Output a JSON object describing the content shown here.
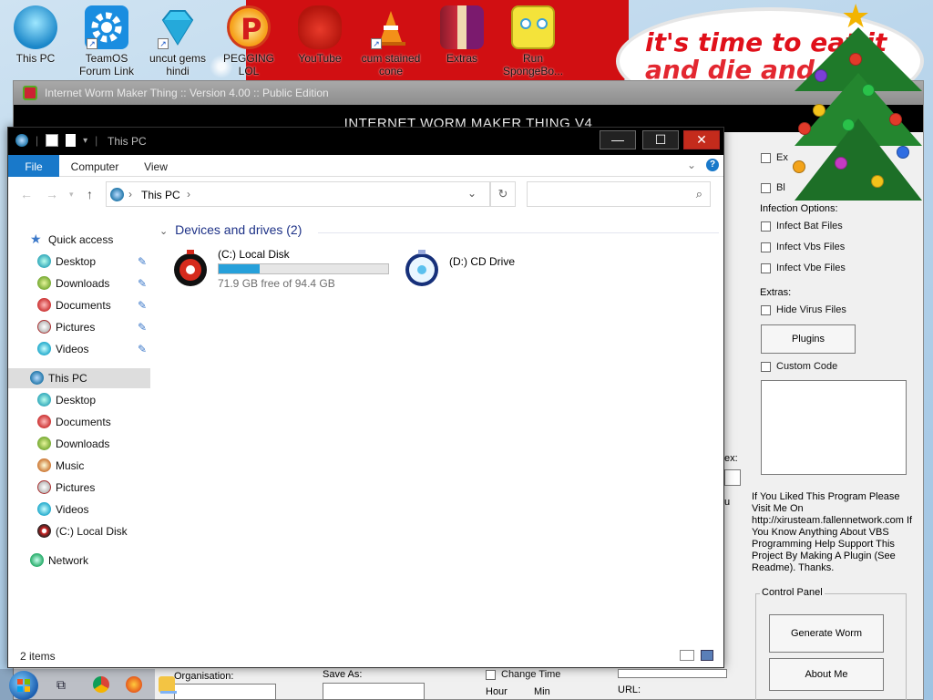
{
  "desktop": {
    "icons": [
      {
        "label": "This PC",
        "icon": "this-pc-icon"
      },
      {
        "label": "TeamOS Forum Link",
        "icon": "gear-icon"
      },
      {
        "label": "uncut gems hindi",
        "icon": "diamond-icon"
      },
      {
        "label": "PEGGING LOL",
        "icon": "letter-p-icon"
      },
      {
        "label": "YouTube",
        "icon": "angry-bird-icon"
      },
      {
        "label": "cum stained cone",
        "icon": "traffic-cone-icon"
      },
      {
        "label": "Extras",
        "icon": "winrar-icon"
      },
      {
        "label": "Run SpongeBo...",
        "icon": "spongebob-icon"
      }
    ],
    "banner": {
      "line1": "it's time to eat it",
      "line2": "and die and"
    }
  },
  "worm_app": {
    "title": "Internet Worm Maker Thing :: Version 4.00 :: Public Edition",
    "heading": "INTERNET WORM MAKER THING V4",
    "checkbox_ex": "Ex",
    "checkbox_bl": "Bl",
    "infection_options_label": "Infection Options:",
    "infect_bat": "Infect Bat Files",
    "infect_vbs": "Infect Vbs Files",
    "infect_vbe": "Infect Vbe Files",
    "extras_label": "Extras:",
    "hide_virus": "Hide Virus Files",
    "plugins_button": "Plugins",
    "custom_code": "Custom Code",
    "partial_ex": "ex:",
    "partial_u": "u",
    "info_text": "If You Liked This Program Please Visit Me On http://xirusteam.fallennetwork.com If You Know Anything About VBS Programming Help Support This Project By Making A Plugin (See Readme). Thanks.",
    "control_panel_label": "Control Panel",
    "generate_button": "Generate Worm",
    "about_button": "About Me",
    "organisation_label": "Organisation:",
    "save_as_label": "Save As:",
    "change_time_label": "Change Time",
    "hour_label": "Hour",
    "min_label": "Min",
    "url_label": "URL:"
  },
  "explorer": {
    "title": "This PC",
    "tabs": [
      "File",
      "Computer",
      "View"
    ],
    "breadcrumb": "This PC",
    "nav": {
      "quick_access": "Quick access",
      "quick_items": [
        "Desktop",
        "Downloads",
        "Documents",
        "Pictures",
        "Videos"
      ],
      "this_pc": "This PC",
      "pc_items": [
        "Desktop",
        "Documents",
        "Downloads",
        "Music",
        "Pictures",
        "Videos",
        "(C:) Local Disk"
      ],
      "network": "Network"
    },
    "group_header": "Devices and drives (2)",
    "drives": [
      {
        "name": "(C:) Local Disk",
        "free_text": "71.9 GB free of 94.4 GB",
        "used_fraction": 0.24
      },
      {
        "name": "(D:) CD Drive"
      }
    ],
    "status": "2 items"
  },
  "colors": {
    "accent": "#1979ca",
    "close": "#c42b1c",
    "drive_bar": "#26a0da",
    "group_header": "#1e3287"
  }
}
